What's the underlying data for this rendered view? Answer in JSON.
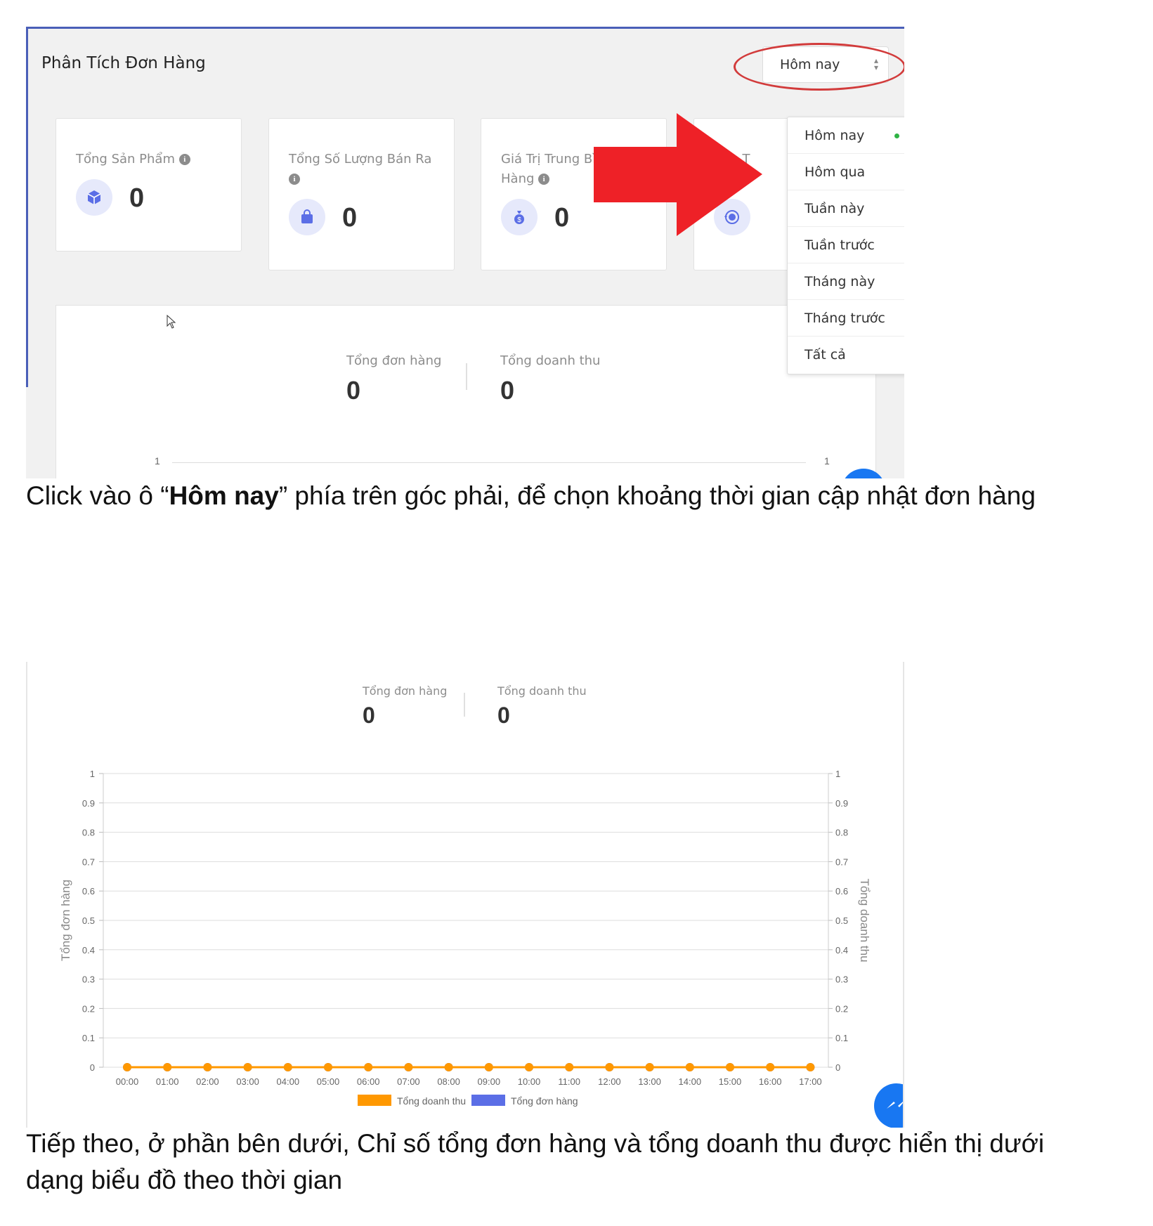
{
  "panel": {
    "title": "Phân Tích Đơn Hàng",
    "period_select": {
      "value": "Hôm nay"
    }
  },
  "cards": [
    {
      "label": "Tổng Sản Phẩm",
      "value": "0",
      "icon": "box-icon"
    },
    {
      "label_line1": "Tổng Số Lượng Bán Ra",
      "value": "0",
      "icon": "shopping-bag-icon"
    },
    {
      "label_line1": "Giá Trị Trung Bì",
      "label_line2": "Hàng",
      "value": "0",
      "icon": "money-bag-icon"
    },
    {
      "label_line1": "nh T",
      "value": "",
      "icon": "refund-icon"
    }
  ],
  "dropdown": {
    "items": [
      "Hôm nay",
      "Hôm qua",
      "Tuần này",
      "Tuần trước",
      "Tháng này",
      "Tháng trước",
      "Tất cả"
    ],
    "selected_index": 0
  },
  "summary": {
    "orders_label": "Tổng đơn hàng",
    "orders_value": "0",
    "revenue_label": "Tổng doanh thu",
    "revenue_value": "0"
  },
  "top_chart_ticks": {
    "left": "1",
    "right": "1"
  },
  "captions": {
    "top_prefix": "Click vào ô “",
    "top_bold": "Hôm nay",
    "top_suffix": "” phía trên góc phải, để chọn khoảng thời gian cập nhật đơn hàng",
    "bottom_line1": "Tiếp theo, ở phần bên dưới, Chỉ số tổng đơn hàng và tổng doanh thu được hiển thị dưới",
    "bottom_line2": "dạng biểu đồ theo thời gian"
  },
  "colors": {
    "accent_border": "#4a5fb8",
    "highlight_ellipse": "#d23b3b",
    "arrow": "#ee2127",
    "revenue_series": "#ff9800",
    "orders_series": "#5b6ee6",
    "selected_dot": "#2fb344"
  },
  "chart_data": {
    "type": "line",
    "categories": [
      "00:00",
      "01:00",
      "02:00",
      "03:00",
      "04:00",
      "05:00",
      "06:00",
      "07:00",
      "08:00",
      "09:00",
      "10:00",
      "11:00",
      "12:00",
      "13:00",
      "14:00",
      "15:00",
      "16:00",
      "17:00"
    ],
    "series": [
      {
        "name": "Tổng doanh thu",
        "axis": "right",
        "values": [
          0,
          0,
          0,
          0,
          0,
          0,
          0,
          0,
          0,
          0,
          0,
          0,
          0,
          0,
          0,
          0,
          0,
          0
        ]
      },
      {
        "name": "Tổng đơn hàng",
        "axis": "left",
        "values": [
          0,
          0,
          0,
          0,
          0,
          0,
          0,
          0,
          0,
          0,
          0,
          0,
          0,
          0,
          0,
          0,
          0,
          0
        ]
      }
    ],
    "ylabel_left": "Tổng đơn hàng",
    "ylabel_right": "Tổng doanh thu",
    "yticks": [
      "0",
      "0.1",
      "0.2",
      "0.3",
      "0.4",
      "0.5",
      "0.6",
      "0.7",
      "0.8",
      "0.9",
      "1"
    ],
    "ylim": [
      0,
      1
    ],
    "grid": true,
    "legend_position": "bottom"
  }
}
